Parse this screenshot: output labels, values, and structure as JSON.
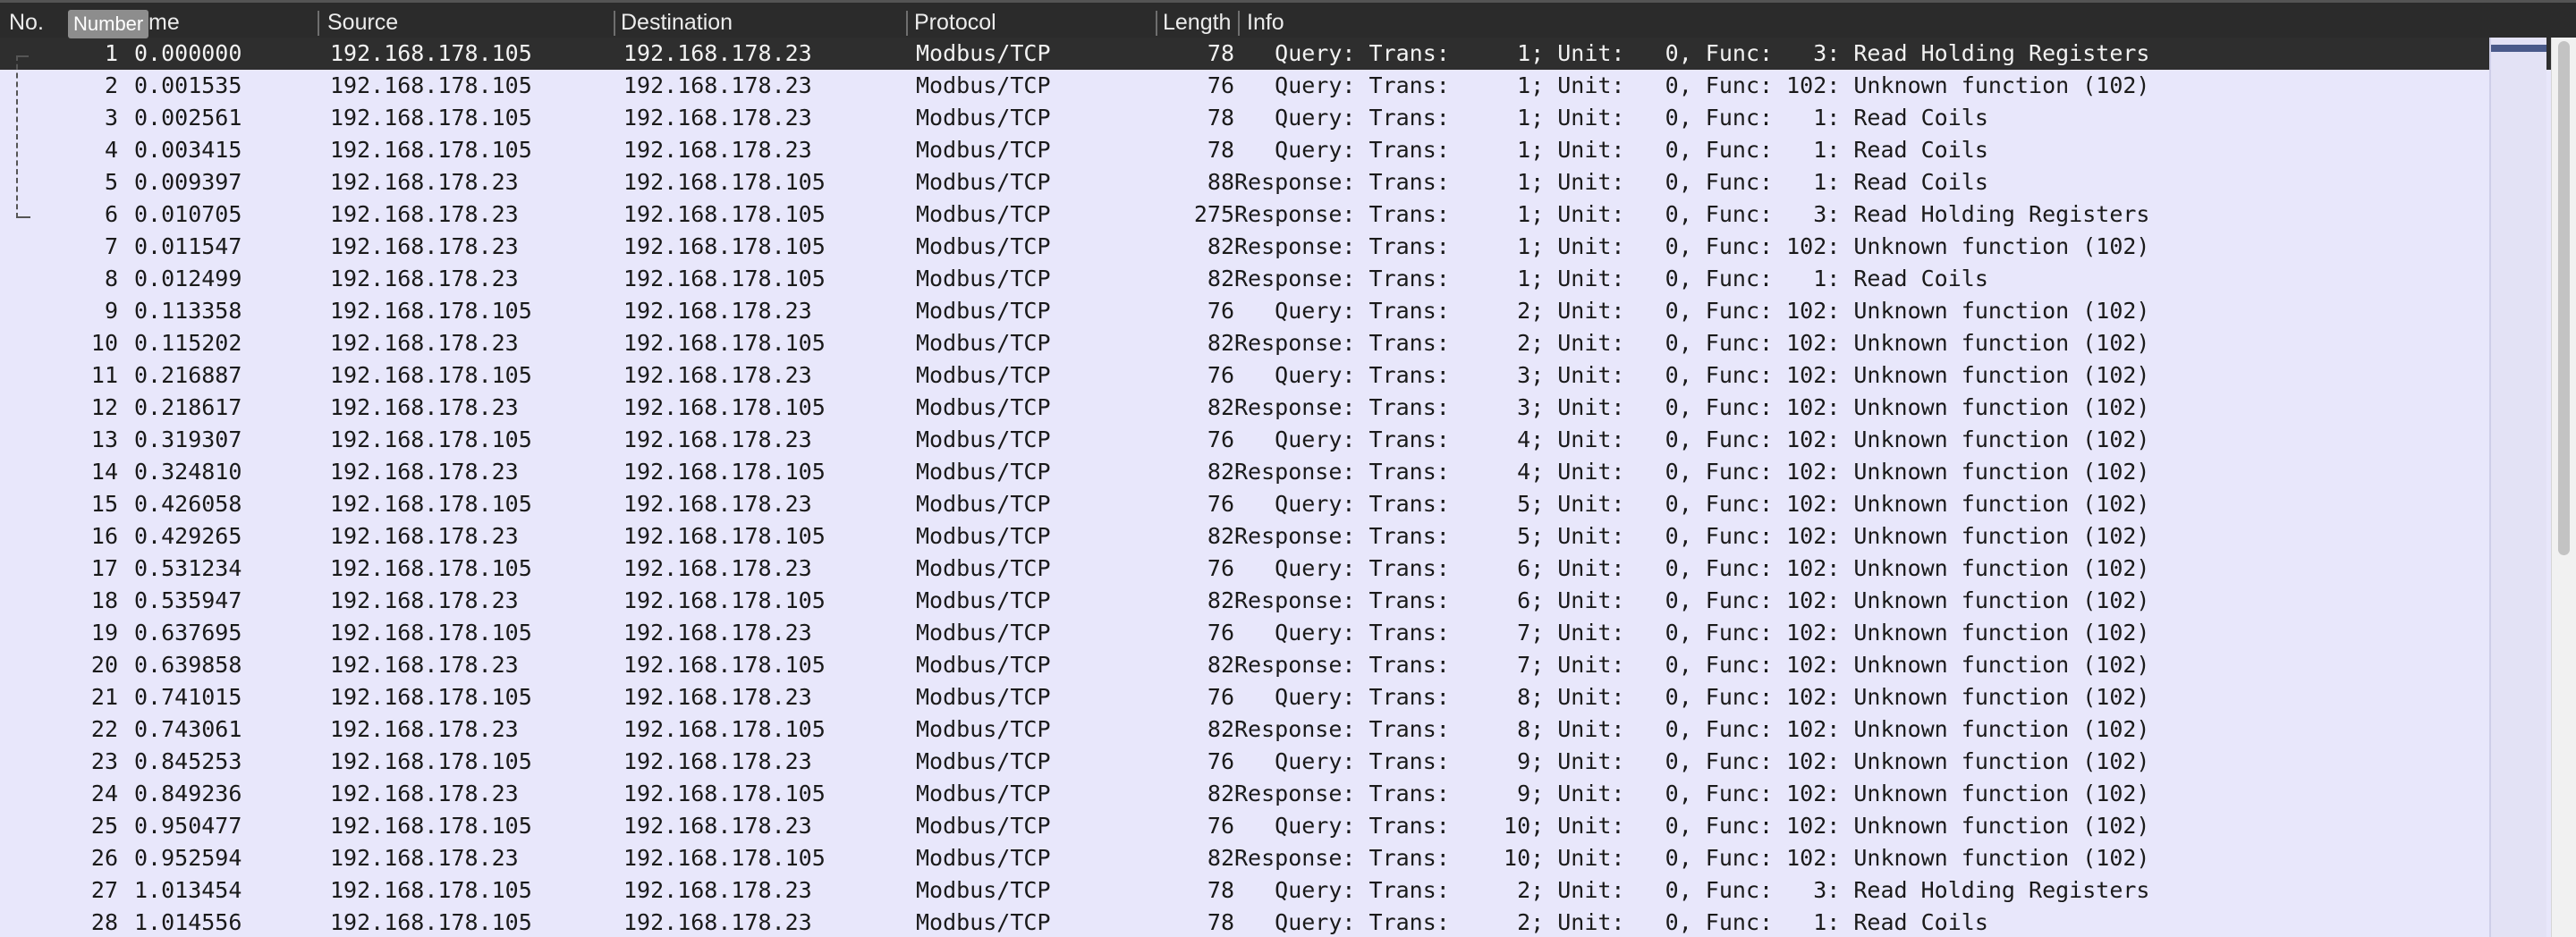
{
  "columns": {
    "no": "No.",
    "time": "me",
    "source": "Source",
    "destination": "Destination",
    "protocol": "Protocol",
    "length": "Length",
    "info": "Info"
  },
  "tooltip": "Number",
  "rows": [
    {
      "no": "1",
      "time": "0.000000",
      "src": "192.168.178.105",
      "dst": "192.168.178.23",
      "proto": "Modbus/TCP",
      "len": "78",
      "info": "   Query: Trans:     1; Unit:   0, Func:   3: Read Holding Registers"
    },
    {
      "no": "2",
      "time": "0.001535",
      "src": "192.168.178.105",
      "dst": "192.168.178.23",
      "proto": "Modbus/TCP",
      "len": "76",
      "info": "   Query: Trans:     1; Unit:   0, Func: 102: Unknown function (102)"
    },
    {
      "no": "3",
      "time": "0.002561",
      "src": "192.168.178.105",
      "dst": "192.168.178.23",
      "proto": "Modbus/TCP",
      "len": "78",
      "info": "   Query: Trans:     1; Unit:   0, Func:   1: Read Coils"
    },
    {
      "no": "4",
      "time": "0.003415",
      "src": "192.168.178.105",
      "dst": "192.168.178.23",
      "proto": "Modbus/TCP",
      "len": "78",
      "info": "   Query: Trans:     1; Unit:   0, Func:   1: Read Coils"
    },
    {
      "no": "5",
      "time": "0.009397",
      "src": "192.168.178.23",
      "dst": "192.168.178.105",
      "proto": "Modbus/TCP",
      "len": "88",
      "info": "Response: Trans:     1; Unit:   0, Func:   1: Read Coils"
    },
    {
      "no": "6",
      "time": "0.010705",
      "src": "192.168.178.23",
      "dst": "192.168.178.105",
      "proto": "Modbus/TCP",
      "len": "275",
      "info": "Response: Trans:     1; Unit:   0, Func:   3: Read Holding Registers"
    },
    {
      "no": "7",
      "time": "0.011547",
      "src": "192.168.178.23",
      "dst": "192.168.178.105",
      "proto": "Modbus/TCP",
      "len": "82",
      "info": "Response: Trans:     1; Unit:   0, Func: 102: Unknown function (102)"
    },
    {
      "no": "8",
      "time": "0.012499",
      "src": "192.168.178.23",
      "dst": "192.168.178.105",
      "proto": "Modbus/TCP",
      "len": "82",
      "info": "Response: Trans:     1; Unit:   0, Func:   1: Read Coils"
    },
    {
      "no": "9",
      "time": "0.113358",
      "src": "192.168.178.105",
      "dst": "192.168.178.23",
      "proto": "Modbus/TCP",
      "len": "76",
      "info": "   Query: Trans:     2; Unit:   0, Func: 102: Unknown function (102)"
    },
    {
      "no": "10",
      "time": "0.115202",
      "src": "192.168.178.23",
      "dst": "192.168.178.105",
      "proto": "Modbus/TCP",
      "len": "82",
      "info": "Response: Trans:     2; Unit:   0, Func: 102: Unknown function (102)"
    },
    {
      "no": "11",
      "time": "0.216887",
      "src": "192.168.178.105",
      "dst": "192.168.178.23",
      "proto": "Modbus/TCP",
      "len": "76",
      "info": "   Query: Trans:     3; Unit:   0, Func: 102: Unknown function (102)"
    },
    {
      "no": "12",
      "time": "0.218617",
      "src": "192.168.178.23",
      "dst": "192.168.178.105",
      "proto": "Modbus/TCP",
      "len": "82",
      "info": "Response: Trans:     3; Unit:   0, Func: 102: Unknown function (102)"
    },
    {
      "no": "13",
      "time": "0.319307",
      "src": "192.168.178.105",
      "dst": "192.168.178.23",
      "proto": "Modbus/TCP",
      "len": "76",
      "info": "   Query: Trans:     4; Unit:   0, Func: 102: Unknown function (102)"
    },
    {
      "no": "14",
      "time": "0.324810",
      "src": "192.168.178.23",
      "dst": "192.168.178.105",
      "proto": "Modbus/TCP",
      "len": "82",
      "info": "Response: Trans:     4; Unit:   0, Func: 102: Unknown function (102)"
    },
    {
      "no": "15",
      "time": "0.426058",
      "src": "192.168.178.105",
      "dst": "192.168.178.23",
      "proto": "Modbus/TCP",
      "len": "76",
      "info": "   Query: Trans:     5; Unit:   0, Func: 102: Unknown function (102)"
    },
    {
      "no": "16",
      "time": "0.429265",
      "src": "192.168.178.23",
      "dst": "192.168.178.105",
      "proto": "Modbus/TCP",
      "len": "82",
      "info": "Response: Trans:     5; Unit:   0, Func: 102: Unknown function (102)"
    },
    {
      "no": "17",
      "time": "0.531234",
      "src": "192.168.178.105",
      "dst": "192.168.178.23",
      "proto": "Modbus/TCP",
      "len": "76",
      "info": "   Query: Trans:     6; Unit:   0, Func: 102: Unknown function (102)"
    },
    {
      "no": "18",
      "time": "0.535947",
      "src": "192.168.178.23",
      "dst": "192.168.178.105",
      "proto": "Modbus/TCP",
      "len": "82",
      "info": "Response: Trans:     6; Unit:   0, Func: 102: Unknown function (102)"
    },
    {
      "no": "19",
      "time": "0.637695",
      "src": "192.168.178.105",
      "dst": "192.168.178.23",
      "proto": "Modbus/TCP",
      "len": "76",
      "info": "   Query: Trans:     7; Unit:   0, Func: 102: Unknown function (102)"
    },
    {
      "no": "20",
      "time": "0.639858",
      "src": "192.168.178.23",
      "dst": "192.168.178.105",
      "proto": "Modbus/TCP",
      "len": "82",
      "info": "Response: Trans:     7; Unit:   0, Func: 102: Unknown function (102)"
    },
    {
      "no": "21",
      "time": "0.741015",
      "src": "192.168.178.105",
      "dst": "192.168.178.23",
      "proto": "Modbus/TCP",
      "len": "76",
      "info": "   Query: Trans:     8; Unit:   0, Func: 102: Unknown function (102)"
    },
    {
      "no": "22",
      "time": "0.743061",
      "src": "192.168.178.23",
      "dst": "192.168.178.105",
      "proto": "Modbus/TCP",
      "len": "82",
      "info": "Response: Trans:     8; Unit:   0, Func: 102: Unknown function (102)"
    },
    {
      "no": "23",
      "time": "0.845253",
      "src": "192.168.178.105",
      "dst": "192.168.178.23",
      "proto": "Modbus/TCP",
      "len": "76",
      "info": "   Query: Trans:     9; Unit:   0, Func: 102: Unknown function (102)"
    },
    {
      "no": "24",
      "time": "0.849236",
      "src": "192.168.178.23",
      "dst": "192.168.178.105",
      "proto": "Modbus/TCP",
      "len": "82",
      "info": "Response: Trans:     9; Unit:   0, Func: 102: Unknown function (102)"
    },
    {
      "no": "25",
      "time": "0.950477",
      "src": "192.168.178.105",
      "dst": "192.168.178.23",
      "proto": "Modbus/TCP",
      "len": "76",
      "info": "   Query: Trans:    10; Unit:   0, Func: 102: Unknown function (102)"
    },
    {
      "no": "26",
      "time": "0.952594",
      "src": "192.168.178.23",
      "dst": "192.168.178.105",
      "proto": "Modbus/TCP",
      "len": "82",
      "info": "Response: Trans:    10; Unit:   0, Func: 102: Unknown function (102)"
    },
    {
      "no": "27",
      "time": "1.013454",
      "src": "192.168.178.105",
      "dst": "192.168.178.23",
      "proto": "Modbus/TCP",
      "len": "78",
      "info": "   Query: Trans:     2; Unit:   0, Func:   3: Read Holding Registers"
    },
    {
      "no": "28",
      "time": "1.014556",
      "src": "192.168.178.105",
      "dst": "192.168.178.23",
      "proto": "Modbus/TCP",
      "len": "78",
      "info": "   Query: Trans:     2; Unit:   0, Func:   1: Read Coils"
    }
  ],
  "selected_row": "1",
  "colors": {
    "row_background": "#e8e7fb",
    "selected_background": "#2e2e2e",
    "header_background": "#2b2b2b",
    "scroll_marker": "#4a5a8a"
  }
}
